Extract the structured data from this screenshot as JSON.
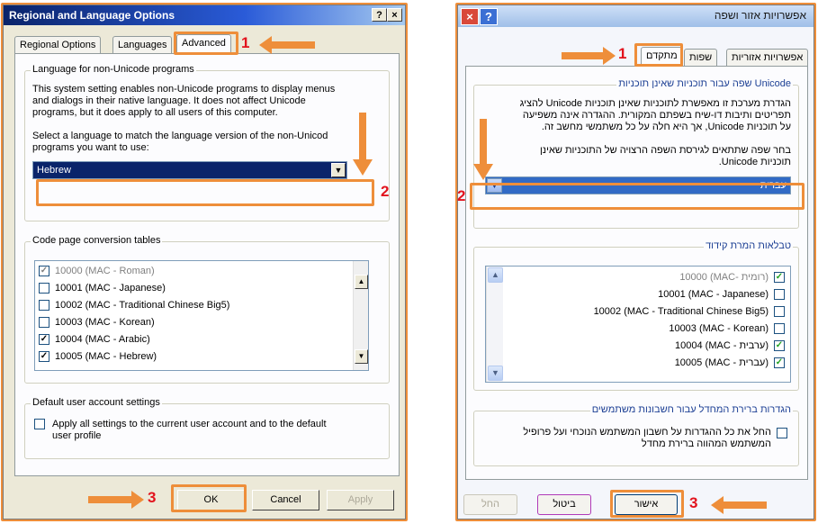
{
  "left_dialog": {
    "title": "Regional and Language Options",
    "help_btn": "?",
    "close_btn": "×",
    "tabs": [
      "Regional Options",
      "Languages",
      "Advanced"
    ],
    "group1_label": "Language for non-Unicode programs",
    "paragraph": [
      "This system setting enables non-Unicode programs to display menus",
      "and dialogs in their native language. It does not affect Unicode",
      "programs, but it does apply to all users of this computer."
    ],
    "select_prompt": [
      "Select a language to match the language version of the non-Unicod",
      "programs you want to use:"
    ],
    "language_value": "Hebrew",
    "group2_label": "Code page conversion tables",
    "code_pages": [
      {
        "label": "10000 (MAC - Roman)",
        "checked": true
      },
      {
        "label": "10001 (MAC - Japanese)",
        "checked": false
      },
      {
        "label": "10002 (MAC - Traditional Chinese Big5)",
        "checked": false
      },
      {
        "label": "10003 (MAC - Korean)",
        "checked": false
      },
      {
        "label": "10004 (MAC - Arabic)",
        "checked": true
      },
      {
        "label": "10005 (MAC - Hebrew)",
        "checked": true
      }
    ],
    "group3_label": "Default user account settings",
    "apply_all": [
      "Apply all settings to the current user account and to the default",
      "user profile"
    ],
    "ok": "OK",
    "cancel": "Cancel",
    "apply": "Apply"
  },
  "right_dialog": {
    "title": "אפשרויות אזור ושפה",
    "close_btn": "×",
    "help_btn": "?",
    "tabs": [
      "אפשרויות אזוריות",
      "שפות",
      "מתקדם"
    ],
    "group1_label": "שפה עבור תוכניות שאינן תוכניות Unicode",
    "paragraph": [
      "הגדרת מערכת זו מאפשרת לתוכניות שאינן תוכניות Unicode להציג",
      "תפריטים ותיבות דו-שיח בשפתם המקורית. ההגדרה אינה משפיעה",
      "על תוכניות Unicode, אך היא חלה על כל משתמשי מחשב זה."
    ],
    "select_prompt": [
      "בחר שפה שתתאים לגירסת השפה הרצויה של התוכניות שאינן",
      "תוכניות Unicode."
    ],
    "language_value": "עברית",
    "group2_label": "טבלאות המרת קידוד",
    "code_pages": [
      {
        "label": "10000 (MAC- רומית)",
        "checked": true
      },
      {
        "label": "10001 (MAC - Japanese)",
        "checked": false
      },
      {
        "label": "10002 (MAC - Traditional Chinese Big5)",
        "checked": false
      },
      {
        "label": "10003 (MAC - Korean)",
        "checked": false
      },
      {
        "label": "10004 (MAC - ערבית)",
        "checked": true
      },
      {
        "label": "10005 (MAC - עברית)",
        "checked": true
      }
    ],
    "group3_label": "הגדרות ברירת המחדל עבור חשבונות משתמשים",
    "apply_all": [
      "החל את כל ההגדרות על חשבון המשתמש הנוכחי ועל פרופיל",
      "המשתמש המהווה ברירת מחדל"
    ],
    "ok": "אישור",
    "cancel": "ביטול",
    "apply": "החל"
  },
  "steps": {
    "one": "1",
    "two": "2",
    "three": "3"
  },
  "colors": {
    "highlight": "#ee8e3a",
    "step_number": "#e2131d",
    "selection": "#0a246a"
  }
}
